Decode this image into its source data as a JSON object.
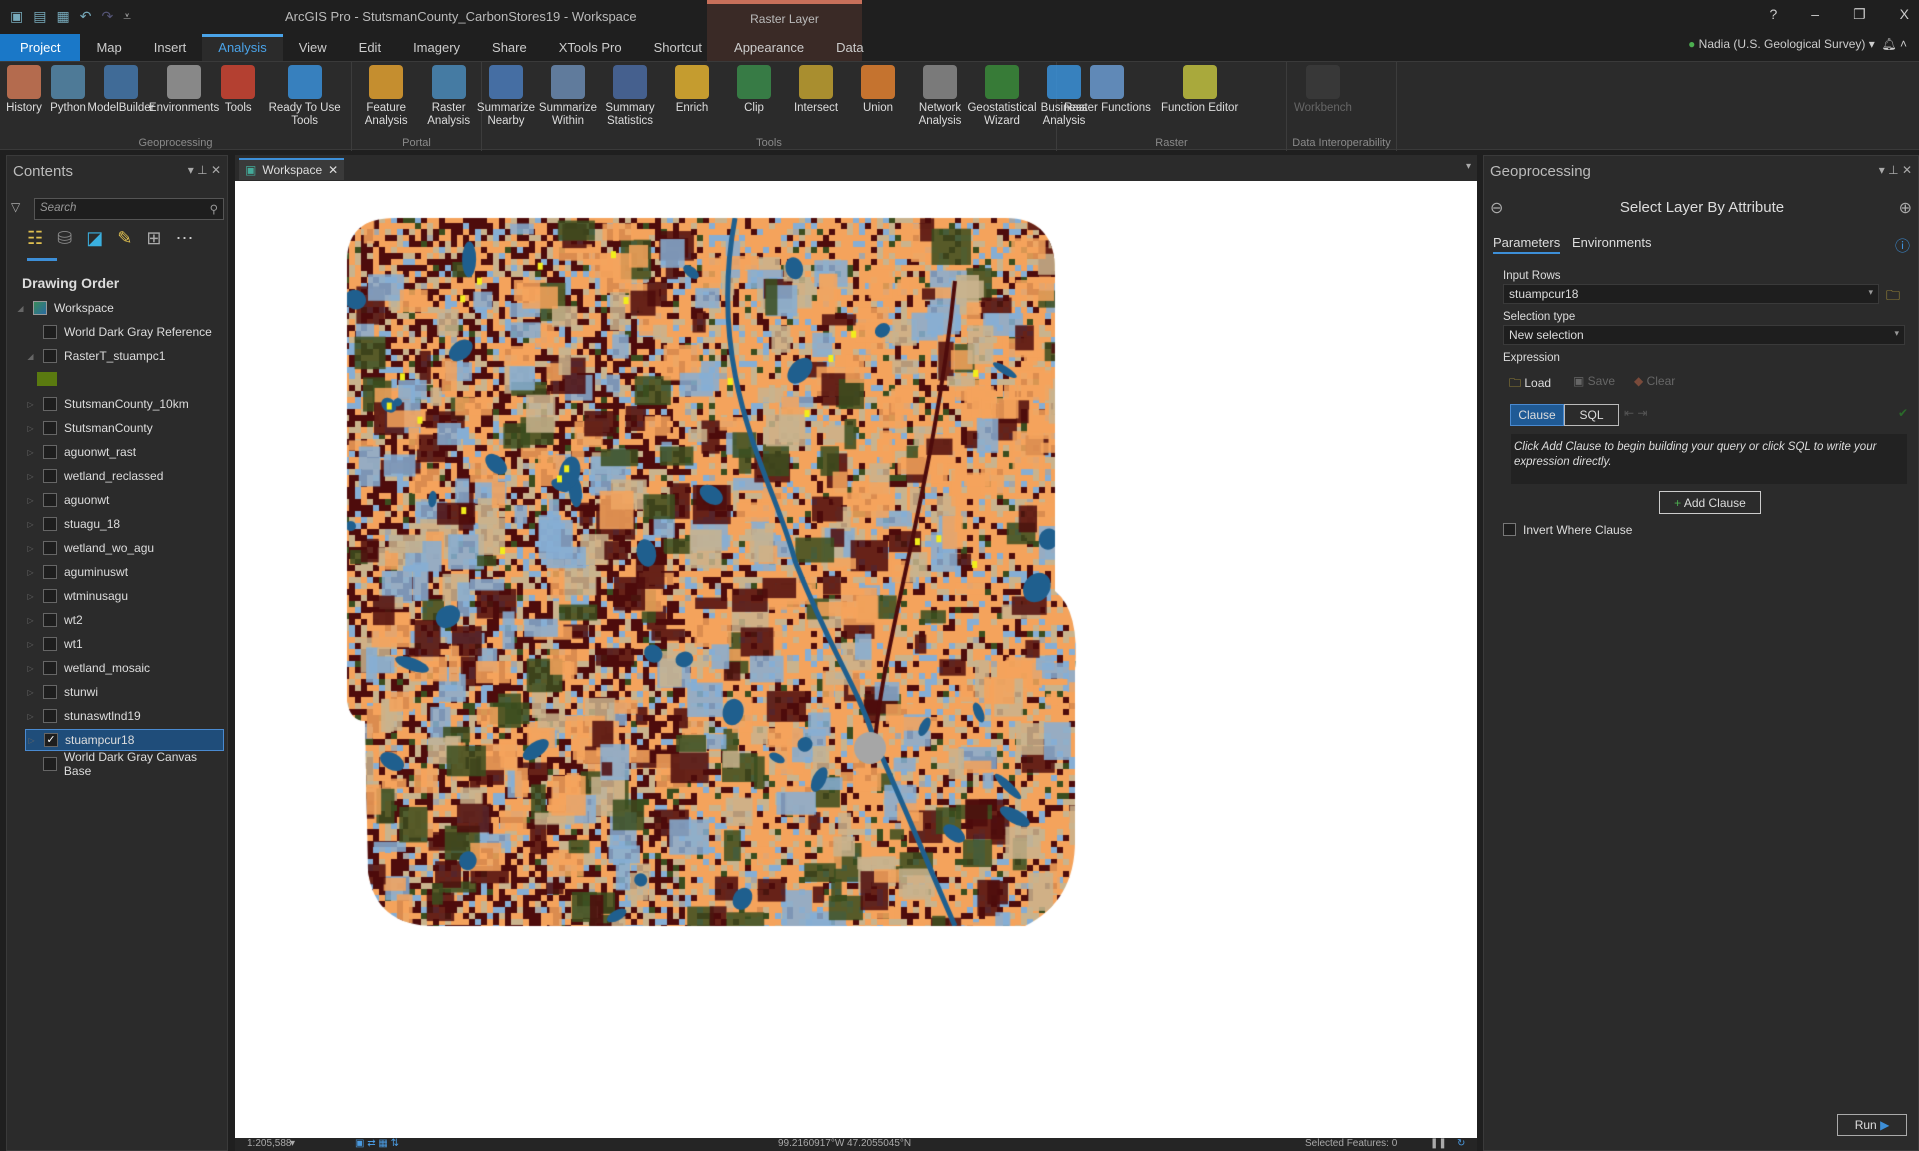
{
  "titlebar": {
    "title": "ArcGIS Pro - StutsmanCounty_CarbonStores19 - Workspace",
    "context_tab": "Raster Layer",
    "help": "?",
    "minimize": "–",
    "restore": "❐",
    "close": "X"
  },
  "tabs": [
    "Project",
    "Map",
    "Insert",
    "Analysis",
    "View",
    "Edit",
    "Imagery",
    "Share",
    "XTools Pro",
    "Shortcut",
    "Appearance",
    "Data"
  ],
  "active_tab": "Analysis",
  "user": {
    "name": "Nadia (U.S. Geological Survey)"
  },
  "ribbon": {
    "groups": [
      {
        "label": "Geoprocessing",
        "buttons": [
          "History",
          "Python",
          "ModelBuilder",
          "Environments",
          "Tools",
          "Ready To Use Tools"
        ]
      },
      {
        "label": "Portal",
        "buttons": [
          "Feature Analysis",
          "Raster Analysis"
        ]
      },
      {
        "label": "Tools",
        "buttons": [
          "Summarize Nearby",
          "Summarize Within",
          "Summary Statistics",
          "Enrich",
          "Clip",
          "Intersect",
          "Union",
          "Network Analysis",
          "Geostatistical Wizard",
          "Business Analysis"
        ]
      },
      {
        "label": "Raster",
        "buttons": [
          "Raster Functions",
          "Function Editor"
        ]
      },
      {
        "label": "Data Interoperability",
        "buttons": [
          "Workbench"
        ]
      }
    ]
  },
  "contents": {
    "title": "Contents",
    "search_placeholder": "Search",
    "drawing_order": "Drawing Order",
    "layers": [
      {
        "name": "Workspace",
        "checked": null,
        "level": 0
      },
      {
        "name": "World Dark Gray Reference",
        "checked": false,
        "level": 1
      },
      {
        "name": "RasterT_stuampc1",
        "checked": false,
        "level": 1
      },
      {
        "name": "StutsmanCounty_10km",
        "checked": false,
        "level": 1
      },
      {
        "name": "StutsmanCounty",
        "checked": false,
        "level": 1
      },
      {
        "name": "aguonwt_rast",
        "checked": false,
        "level": 1
      },
      {
        "name": "wetland_reclassed",
        "checked": false,
        "level": 1
      },
      {
        "name": "aguonwt",
        "checked": false,
        "level": 1
      },
      {
        "name": "stuagu_18",
        "checked": false,
        "level": 1
      },
      {
        "name": "wetland_wo_agu",
        "checked": false,
        "level": 1
      },
      {
        "name": "aguminuswt",
        "checked": false,
        "level": 1
      },
      {
        "name": "wtminusagu",
        "checked": false,
        "level": 1
      },
      {
        "name": "wt2",
        "checked": false,
        "level": 1
      },
      {
        "name": "wt1",
        "checked": false,
        "level": 1
      },
      {
        "name": "wetland_mosaic",
        "checked": false,
        "level": 1
      },
      {
        "name": "stunwi",
        "checked": false,
        "level": 1
      },
      {
        "name": "stunaswtlnd19",
        "checked": false,
        "level": 1
      },
      {
        "name": "stuampcur18",
        "checked": true,
        "level": 1,
        "selected": true
      },
      {
        "name": "World Dark Gray Canvas Base",
        "checked": false,
        "level": 1
      }
    ]
  },
  "map": {
    "tab": "Workspace",
    "palette": {
      "orange": "#f4a35c",
      "darkred": "#4e0c0c",
      "tan": "#c9b38d",
      "lightblue": "#86aed4",
      "water": "#1f5f8e",
      "green": "#3b4d1f",
      "gray": "#a6a6a6",
      "yellow": "#f2ee1a"
    }
  },
  "status": {
    "scale": "1:205,588",
    "coords": "99.2160917°W 47.2055045°N",
    "selected": "Selected Features: 0"
  },
  "geoprocessing": {
    "title": "Geoprocessing",
    "tool": "Select Layer By Attribute",
    "tabs": [
      "Parameters",
      "Environments"
    ],
    "input_rows_label": "Input Rows",
    "input_rows": "stuampcur18",
    "selection_type_label": "Selection type",
    "selection_type": "New selection",
    "expression_label": "Expression",
    "load": "Load",
    "save": "Save",
    "clear": "Clear",
    "clause": "Clause",
    "sql": "SQL",
    "hint": "Click Add Clause to begin building your query or click SQL to write your expression directly.",
    "add_clause": "Add Clause",
    "invert": "Invert Where Clause",
    "run": "Run"
  }
}
